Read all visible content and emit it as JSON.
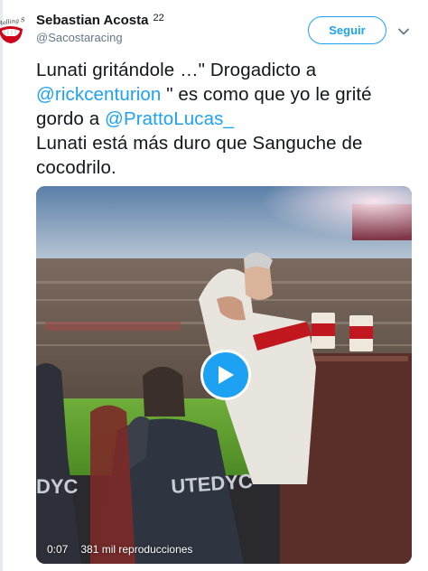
{
  "author": {
    "display_name": "Sebastian Acosta",
    "name_suffix": "22",
    "handle": "@Sacostaracing",
    "avatar_text": "Rolling Stones"
  },
  "actions": {
    "follow_label": "Seguir",
    "menu_icon": "chevron-down-icon"
  },
  "tweet": {
    "segments": [
      {
        "text": "Lunati gritándole …\" Drogadicto a ",
        "type": "text"
      },
      {
        "text": "@rickcenturion",
        "type": "mention"
      },
      {
        "text": " \" es como que yo le grité gordo a ",
        "type": "text"
      },
      {
        "text": "@PrattoLucas_",
        "type": "mention"
      },
      {
        "text": "\nLunati está más duro que Sanguche de cocodrilo.",
        "type": "text"
      }
    ]
  },
  "media": {
    "type": "video",
    "play_icon": "play-icon",
    "duration": "0:07",
    "views": "381 mil reproducciones",
    "shirt_text": "UTEDYC",
    "shirt_text_left": "DYC"
  },
  "colors": {
    "accent": "#1da1f2",
    "text": "#14171a",
    "muted": "#657786"
  }
}
